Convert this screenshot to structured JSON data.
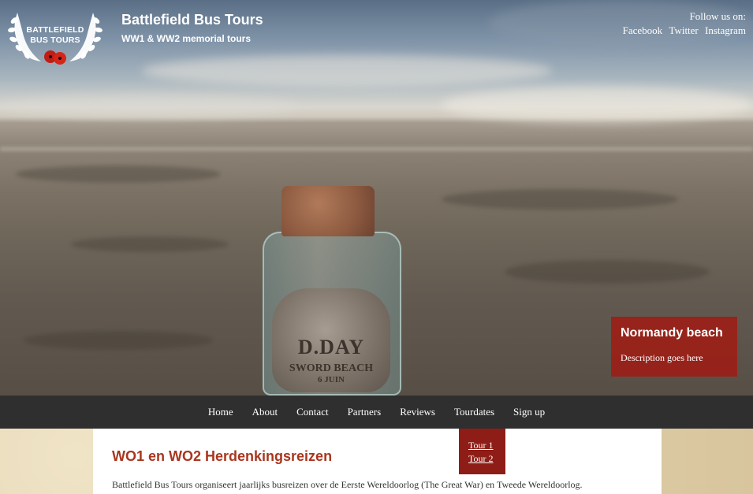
{
  "header": {
    "logo_text_line1": "BATTLEFIELD",
    "logo_text_line2": "BUS TOURS",
    "site_title": "Battlefield Bus Tours",
    "site_subtitle": "WW1 & WW2 memorial tours"
  },
  "social": {
    "label": "Follow us on:",
    "links": [
      "Facebook",
      "Twitter",
      "Instagram"
    ]
  },
  "hero": {
    "jar_text1": "D.DAY",
    "jar_text2": "SWORD BEACH",
    "jar_text3": "6 JUIN",
    "caption_title": "Normandy beach",
    "caption_description": "Description goes here"
  },
  "nav": {
    "items": [
      "Home",
      "About",
      "Contact",
      "Partners",
      "Reviews",
      "Tourdates",
      "Sign up"
    ]
  },
  "dropdown": {
    "items": [
      "Tour 1",
      "Tour 2"
    ]
  },
  "content": {
    "heading": "WO1 en WO2 Herdenkingsreizen",
    "text": "Battlefield Bus Tours organiseert jaarlijks busreizen over de Eerste Wereldoorlog (The Great War) en Tweede Wereldoorlog."
  },
  "colors": {
    "accent_red": "#a01c14",
    "nav_bg": "#2f2f2f",
    "heading_red": "#a8361f"
  }
}
